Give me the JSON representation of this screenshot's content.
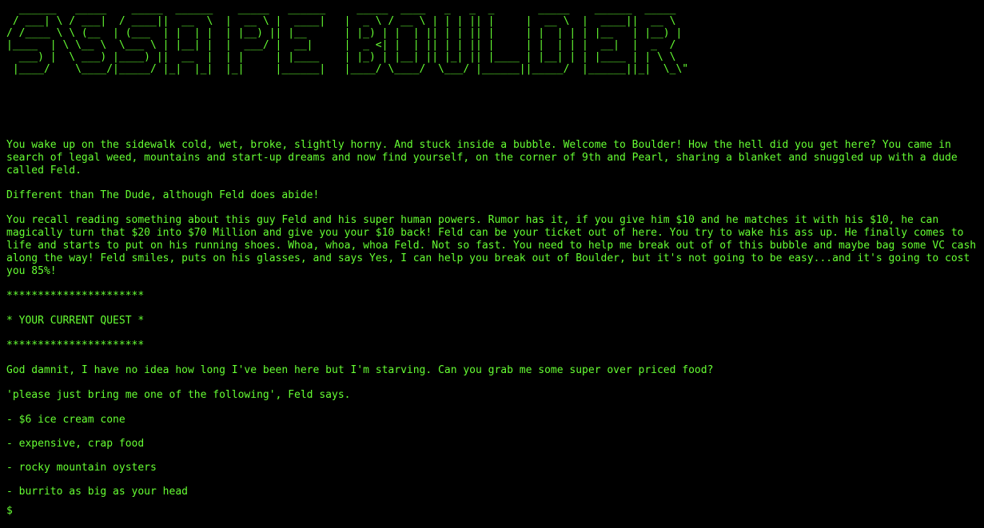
{
  "banner_art": "  ______   _____    _____  ______    _____   ______     _____  ____   _   _  _       _____    ______  _____ \n / ___| \\ / ___|  / ____||  __  \\  |  __ \\ |  ____|   |  _ \\ / __ \\ | | | || |     |  __ \\  |  ____||  __ \\\n/ /____ \\ \\ (__  | (___  | |  | |  | |__) || |__      | |_) | |  | || | | || |     | |  | | | |__   | |__) |\n|____  | \\ \\__ \\  \\___ \\ | |__| |  |  ___/ |  __|     |  _ <| |  | || | | || |     | |  | | |  __|  |  _  /\n  ___) |  \\ ___) |____) ||  __  |  | |     | |____    | |_) | |__| || |_| || |____ | |__| | | |____ | | \\ \\\n |____/    \\____/|_____/ |_|  |_|  |_|     |______|   |____/ \\____/  \\___/ |______||_____/  |______||_|  \\_\\\"",
  "story": {
    "intro": "You wake up on the sidewalk cold, wet, broke, slightly horny. And stuck inside a bubble. Welcome to Boulder! How the hell did you get here? You came in search of legal weed, mountains and start-up dreams and now find yourself, on the corner of 9th and Pearl, sharing a blanket and snuggled up with a dude called Feld.",
    "dude": "Different than The Dude, although Feld does abide!",
    "recall": "You recall reading something about this guy Feld and his super human powers. Rumor has it, if you give him $10 and he matches it with his $10, he can magically turn that $20 into $70 Million and give you your $10 back! Feld can be your ticket out of here. You try to wake his ass up. He finally comes to life and starts to put on his running shoes. Whoa, whoa, whoa Feld. Not so fast. You need to help me break out of of this bubble and maybe bag some VC cash along the way! Feld smiles, puts on his glasses, and says Yes, I can help you break out of Boulder, but it's not going to be easy...and it's going to cost you 85%!"
  },
  "quest": {
    "stars_top": "**********************",
    "heading": "* YOUR CURRENT QUEST *",
    "stars_bottom": "**********************",
    "request": "God damnit, I have no idea how long I've been here but I'm starving. Can you grab me some super over priced food?",
    "instruction": "'please just bring me one of the following', Feld says.",
    "options": [
      "- $6 ice cream cone",
      "- expensive, crap food",
      "- rocky mountain oysters",
      "- burrito as big as your head"
    ]
  },
  "prompt": {
    "symbol": "$"
  },
  "colors": {
    "background": "#000000",
    "text": "#66ff33"
  }
}
